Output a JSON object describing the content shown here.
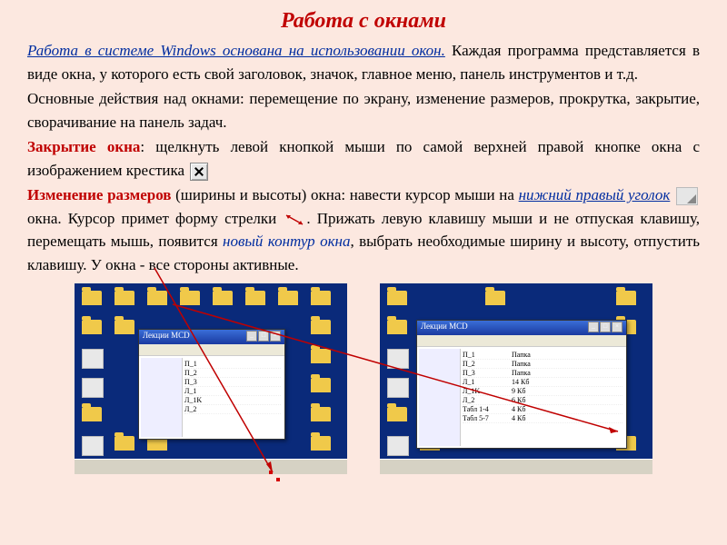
{
  "title": "Работа с окнами",
  "para1": {
    "lead": "Работа в системе Windows основана на использовании окон.",
    "rest": " Каждая программа представляется в виде окна, у которого есть свой заголовок, значок, главное меню, панель инструментов и т.д."
  },
  "para2": "Основные действия над окнами: перемещение по экрану, изменение размеров, прокрутка, закрытие, сворачивание на панель задач.",
  "para3": {
    "label": "Закрытие окна",
    "text": ": щелкнуть левой кнопкой мыши по самой верхней правой кнопке окна с изображением крестика"
  },
  "para4": {
    "label": "Изменение размеров",
    "t1": " (ширины и высоты) окна: навести курсор мыши на ",
    "corner": "нижний правый уголок",
    "t2": " окна. Курсор примет форму стрелки ",
    "t3": ". Прижать левую клавишу мыши и не отпуская клавишу, перемещать мышь, появится ",
    "outline": "новый контур окна",
    "t4": ",  выбрать необходимые ширину и высоту, отпустить клавишу. У окна - все стороны активные."
  },
  "window_title": "Лекции MCD"
}
